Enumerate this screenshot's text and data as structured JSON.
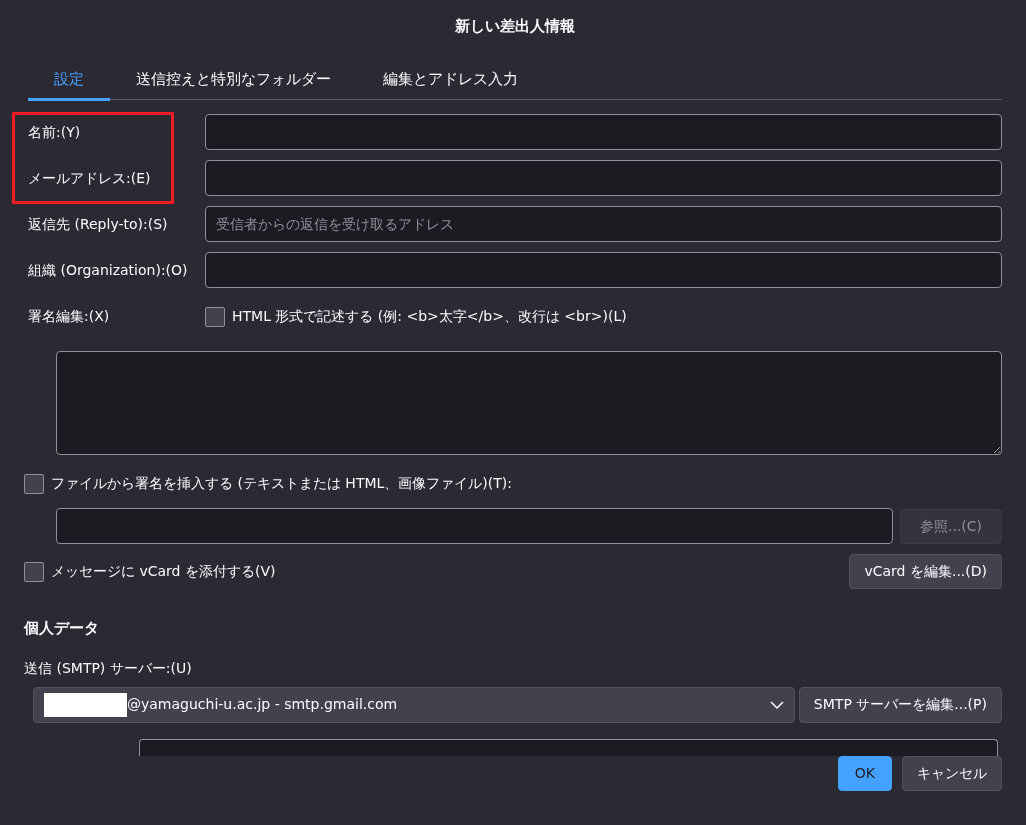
{
  "window": {
    "title": "新しい差出人情報"
  },
  "tabs": [
    {
      "label": "設定",
      "selected": true
    },
    {
      "label": "送信控えと特別なフォルダー",
      "selected": false
    },
    {
      "label": "編集とアドレス入力",
      "selected": false
    }
  ],
  "label_highlight": true,
  "fields": [
    {
      "label": "名前:(Y)"
    },
    {
      "label": "メールアドレス:(E)"
    },
    {
      "label": "返信先 (Reply-to):(S)",
      "placeholder": "受信者からの返信を受け取るアドレス"
    },
    {
      "label": "組織 (Organization):(O)"
    }
  ],
  "signature": {
    "label": "署名編集:(X)",
    "html_checkbox": {
      "label": "HTML 形式で記述する (例: <b>太字</b>、改行は <br>)(L)",
      "checked": false
    }
  },
  "file_signature": {
    "label": "ファイルから署名を挿入する (テキストまたは HTML、画像ファイル)(T):",
    "checked": false,
    "browse_button": {
      "label": "参照...(C)",
      "disabled": true
    }
  },
  "vcard": {
    "label": "メッセージに vCard を添付する(V)",
    "checked": false,
    "edit_button": "vCard を編集...(D)"
  },
  "personal": {
    "heading": "個人データ",
    "smtp_label": "送信 (SMTP) サーバー:(U)",
    "smtp_value": "@yamaguchi-u.ac.jp - smtp.gmail.com",
    "smtp_button": "SMTP サーバーを編集...(P)"
  },
  "buttons": [
    {
      "label": "OK",
      "kind": "primary"
    },
    {
      "label": "キャンセル",
      "kind": "secondary"
    }
  ]
}
